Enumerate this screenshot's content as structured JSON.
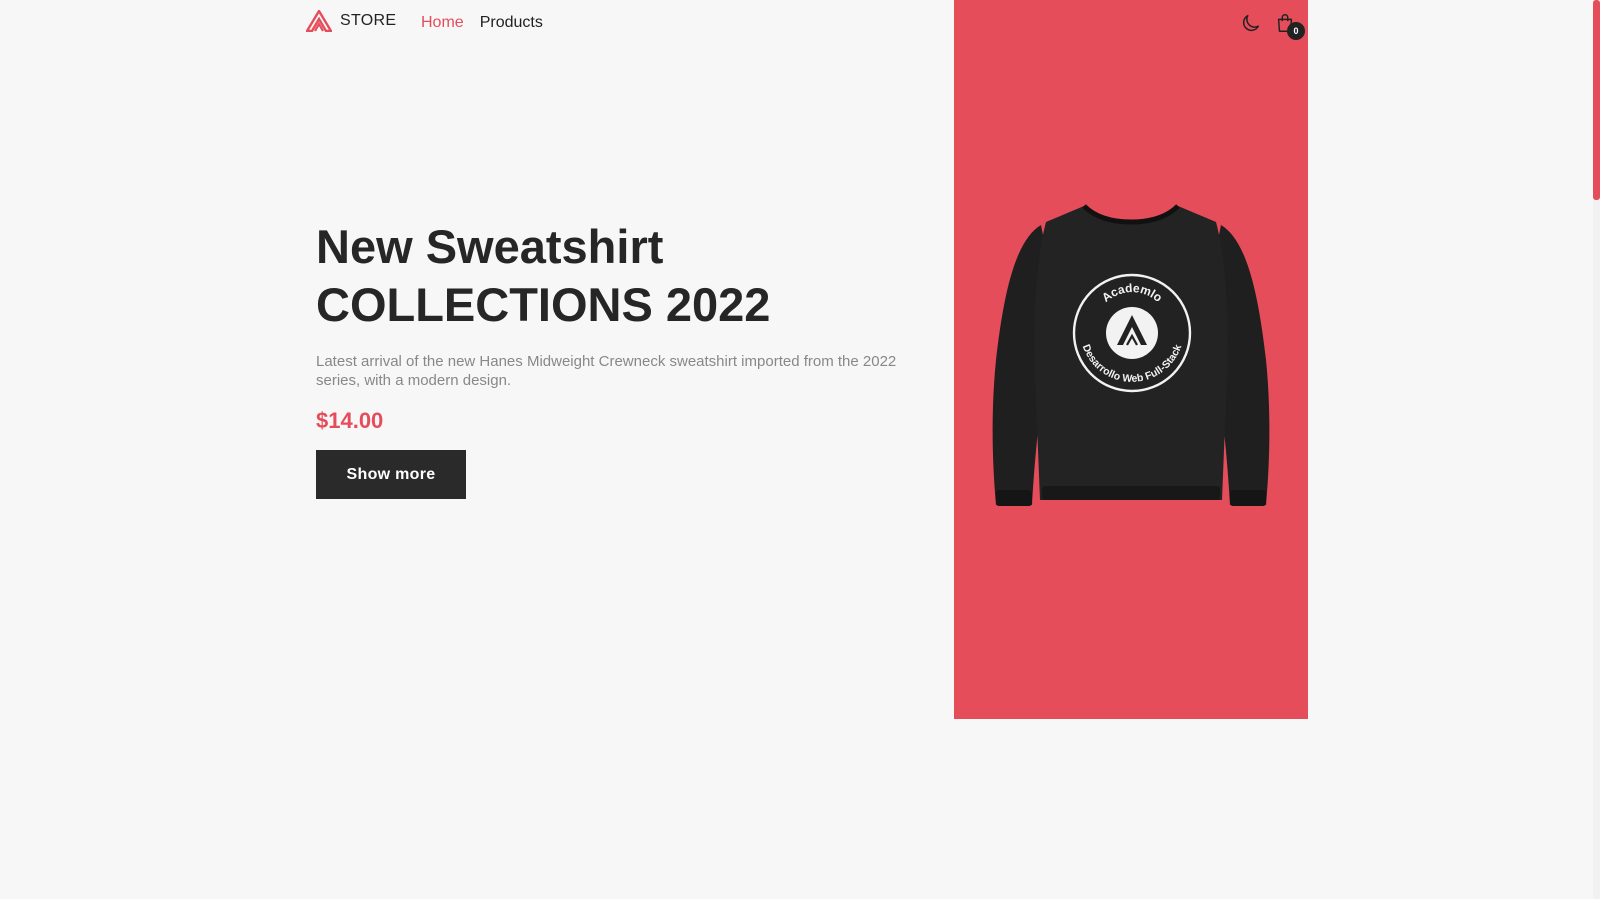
{
  "colors": {
    "accent": "#e54d5a",
    "text": "#222222",
    "muted": "#888888",
    "background": "#f7f7f7",
    "button": "#2a2a2a"
  },
  "header": {
    "logo_icon": "academlo-logo-icon",
    "logo_text": "STORE",
    "nav": {
      "home": "Home",
      "products": "Products"
    },
    "theme_icon": "moon-icon",
    "cart_icon": "shopping-bag-icon",
    "cart_count": "0"
  },
  "hero": {
    "title_line1": "New Sweatshirt",
    "title_line2": "COLLECTIONS 2022",
    "description": "Latest arrival of the new Hanes Midweight Crewneck sweatshirt imported from the 2022 series, with a modern design.",
    "price": "$14.00",
    "button_label": "Show more",
    "image": "black-sweatshirt-image",
    "image_alt": "Black crewneck sweatshirt with Academlo logo",
    "shirt_badge_top": "Academlo",
    "shirt_badge_bottom": "Desarrollo Web Full-Stack"
  }
}
